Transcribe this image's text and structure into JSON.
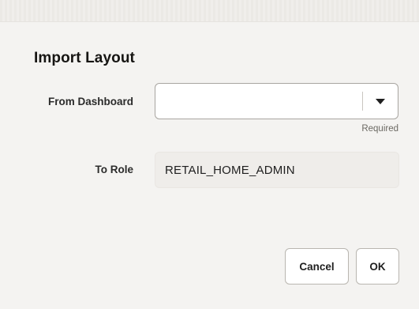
{
  "dialog": {
    "title": "Import Layout"
  },
  "form": {
    "from_dashboard": {
      "label": "From Dashboard",
      "value": "",
      "required_text": "Required"
    },
    "to_role": {
      "label": "To Role",
      "value": "RETAIL_HOME_ADMIN"
    }
  },
  "buttons": {
    "cancel": "Cancel",
    "ok": "OK"
  },
  "icons": {
    "dropdown": "caret-down-icon"
  }
}
